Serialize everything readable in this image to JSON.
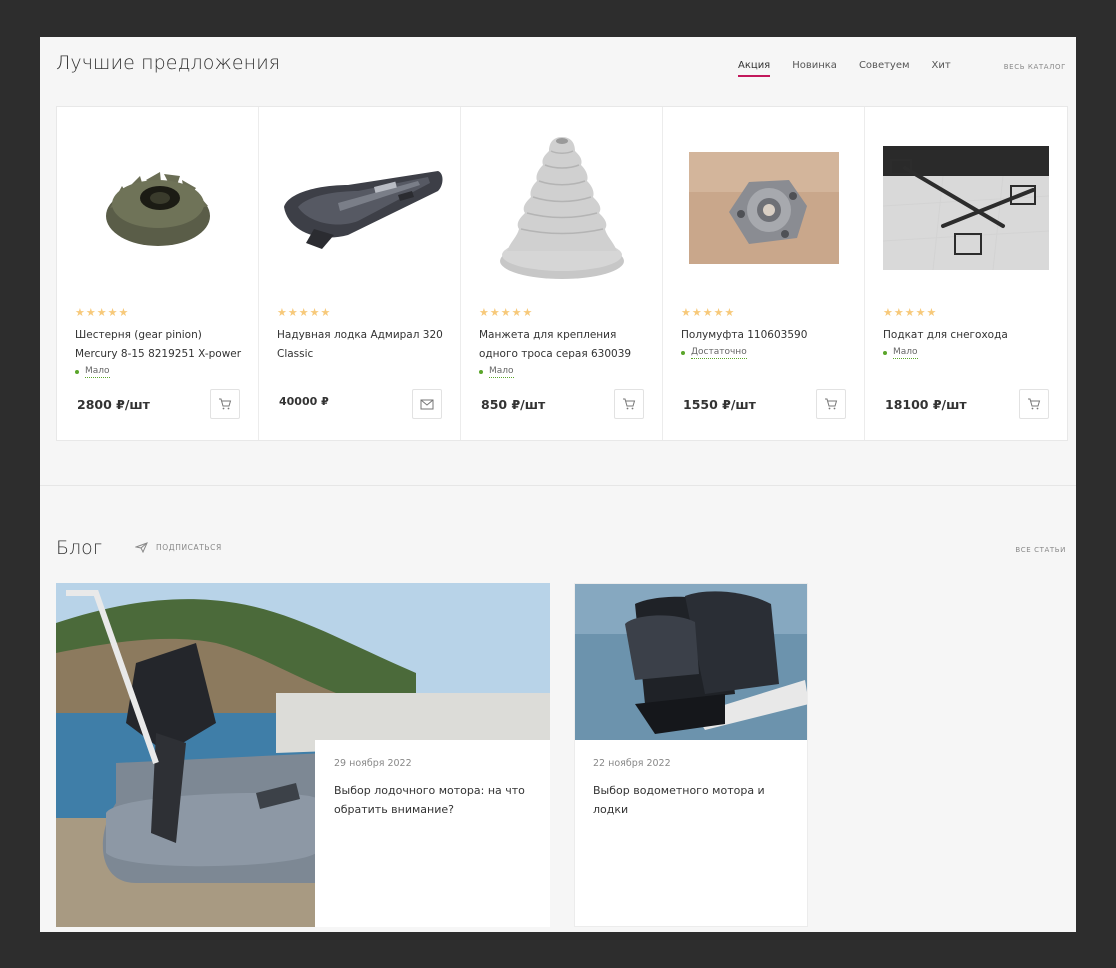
{
  "offers": {
    "title": "Лучшие предложения",
    "tabs": [
      "Акция",
      "Новинка",
      "Советуем",
      "Хит"
    ],
    "active_tab": "Акция",
    "catalog_link": "весь каталог"
  },
  "products": [
    {
      "name": "Шестерня (gear pinion) Mercury 8-15 8219251 X-power",
      "rating": 5,
      "stock": "Мало",
      "price": "2800 ₽/шт",
      "button": "cart-icon"
    },
    {
      "name": "Надувная лодка Адмирал 320 Classic",
      "rating": 5,
      "stock": "",
      "price": "40000 ₽",
      "button": "mail-icon"
    },
    {
      "name": "Манжета для крепления одного троса серая 630039",
      "rating": 5,
      "stock": "Мало",
      "price": "850 ₽/шт",
      "button": "cart-icon"
    },
    {
      "name": "Полумуфта 110603590",
      "rating": 5,
      "stock": "Достаточно",
      "price": "1550 ₽/шт",
      "button": "cart-icon"
    },
    {
      "name": "Подкат для снегохода",
      "rating": 5,
      "stock": "Мало",
      "price": "18100 ₽/шт",
      "button": "cart-icon"
    }
  ],
  "blog": {
    "title": "Блог",
    "subscribe": "подписаться",
    "all_articles": "все статьи",
    "posts": [
      {
        "date": "29 ноября 2022",
        "title": "Выбор лодочного мотора: на что обратить внимание?"
      },
      {
        "date": "22 ноября 2022",
        "title": "Выбор водометного мотора и лодки"
      }
    ]
  },
  "colors": {
    "accent": "#c2185b",
    "star": "#f7c97a",
    "stock_dot": "#5aa52a",
    "frame": "#2d2d2d"
  }
}
